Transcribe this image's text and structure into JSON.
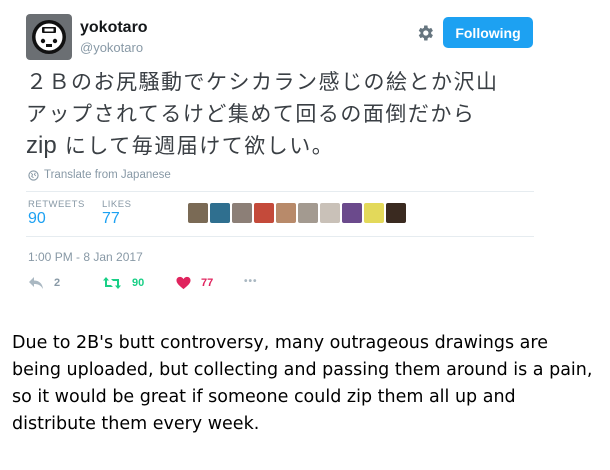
{
  "tweet": {
    "display_name": "yokotaro",
    "handle": "@yokotaro",
    "follow_button_label": "Following",
    "text_lines": [
      "２Ｂのお尻騒動でケシカラン感じの絵とか沢山",
      "アップされてるけど集めて回るの面倒だから",
      "zip にして毎週届けて欲しい。"
    ],
    "translate_link": "Translate from Japanese",
    "stats": {
      "retweets_label": "RETWEETS",
      "retweets_value": "90",
      "likes_label": "LIKES",
      "likes_value": "77"
    },
    "liker_avatar_colors": [
      "#7a6a55",
      "#2f6f8f",
      "#8c7f77",
      "#c44a3a",
      "#b88a6a",
      "#a39a90",
      "#c9c1b8",
      "#6b4a8c",
      "#e3d95a",
      "#3a2a20"
    ],
    "timestamp": "1:00 PM - 8 Jan 2017",
    "actions": {
      "reply_count": "2",
      "retweet_count": "90",
      "like_count": "77",
      "more_label": "•••"
    },
    "colors": {
      "accent": "#1da1f2",
      "retweet_green": "#19cf86",
      "like_red": "#e0245e",
      "muted": "#8899a6"
    }
  },
  "caption": "Due to 2B's butt controversy, many outrageous drawings are being uploaded, but collecting and passing them around is a pain, so it would be great if someone could zip them all up and distribute them every week."
}
